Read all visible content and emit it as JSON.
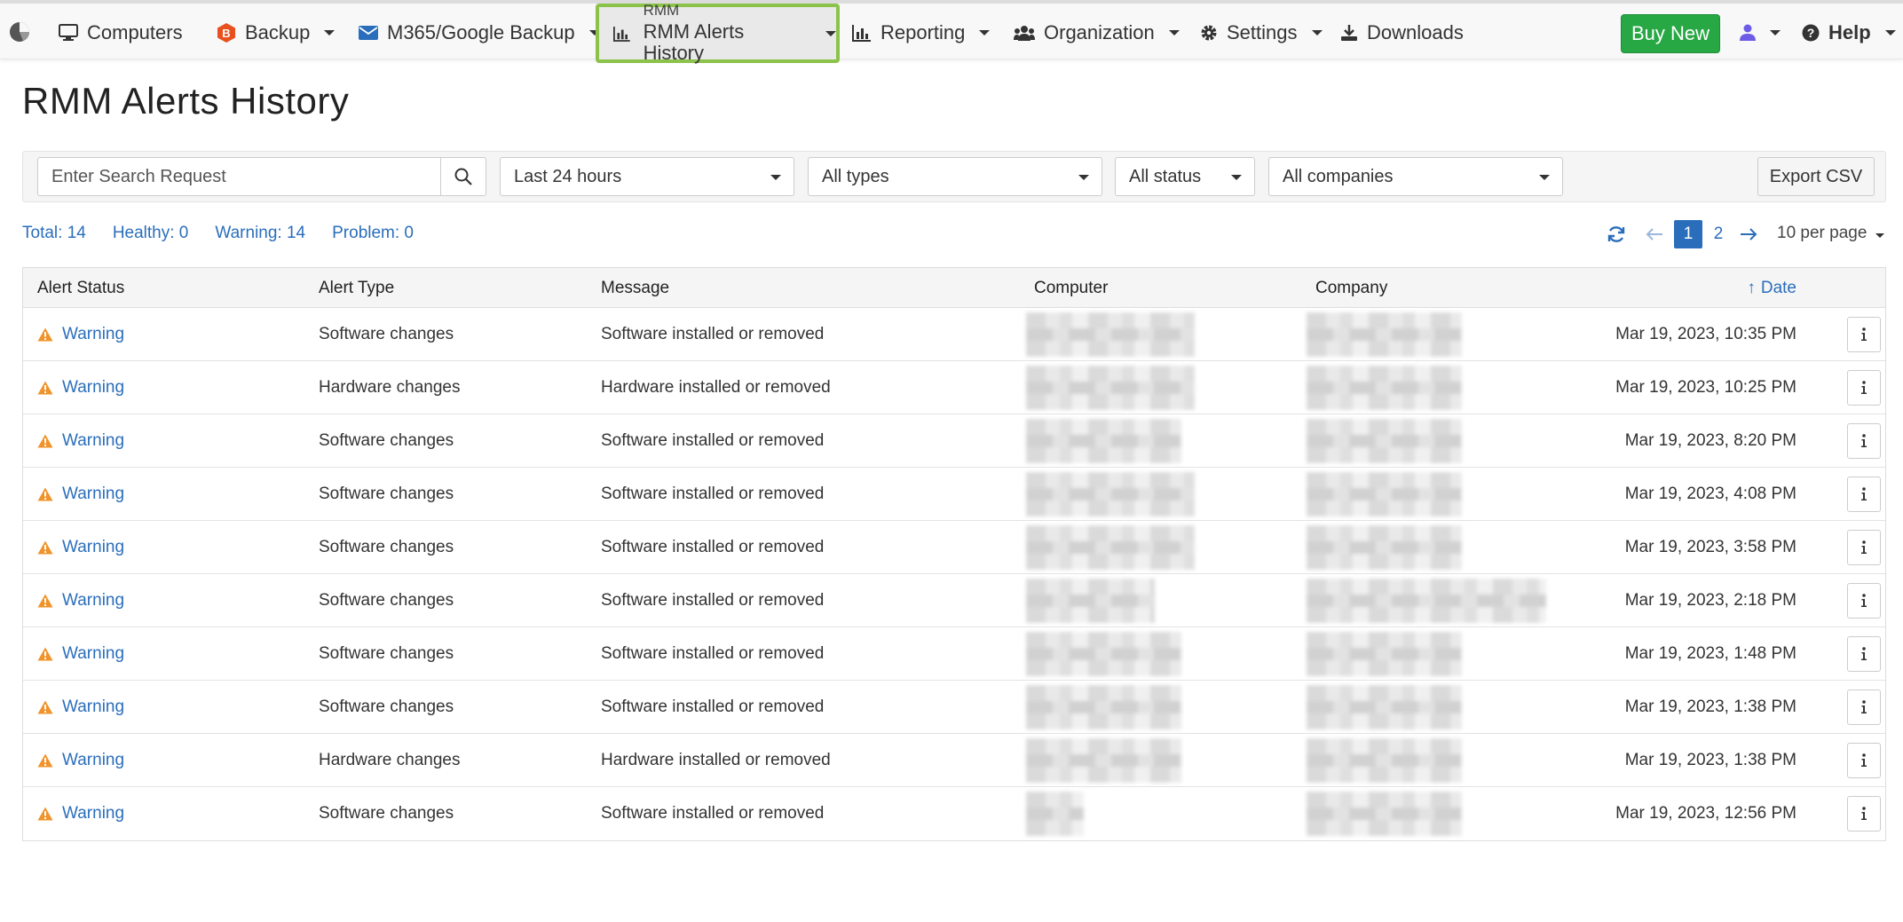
{
  "nav": {
    "items": [
      {
        "label": "Computers",
        "icon": "monitor-icon"
      },
      {
        "label": "Backup",
        "icon": "backup-icon"
      },
      {
        "label": "M365/Google Backup",
        "icon": "envelope-icon"
      },
      {
        "label_small": "RMM",
        "label": "RMM Alerts History",
        "icon": "bar-chart-icon"
      },
      {
        "label": "Reporting",
        "icon": "bar-chart-icon"
      },
      {
        "label": "Organization",
        "icon": "users-icon"
      },
      {
        "label": "Settings",
        "icon": "gear-icon"
      },
      {
        "label": "Downloads",
        "icon": "download-icon"
      }
    ],
    "buy_new": "Buy New",
    "help": "Help"
  },
  "page": {
    "title": "RMM Alerts History"
  },
  "filters": {
    "search_placeholder": "Enter Search Request",
    "period": "Last 24 hours",
    "types": "All types",
    "status": "All status",
    "companies": "All companies",
    "export": "Export CSV"
  },
  "stats": {
    "total": "Total: 14",
    "healthy": "Healthy: 0",
    "warning": "Warning: 14",
    "problem": "Problem: 0"
  },
  "pagination": {
    "pages": [
      "1",
      "2"
    ],
    "current": "1",
    "per_page": "10 per page"
  },
  "table": {
    "columns": [
      "Alert Status",
      "Alert Type",
      "Message",
      "Computer",
      "Company",
      "Date"
    ],
    "sort_indicator": "↑",
    "rows": [
      {
        "status": "Warning",
        "type": "Software changes",
        "message": "Software installed or removed",
        "date": "Mar 19, 2023, 10:35 PM"
      },
      {
        "status": "Warning",
        "type": "Hardware changes",
        "message": "Hardware installed or removed",
        "date": "Mar 19, 2023, 10:25 PM"
      },
      {
        "status": "Warning",
        "type": "Software changes",
        "message": "Software installed or removed",
        "date": "Mar 19, 2023, 8:20 PM"
      },
      {
        "status": "Warning",
        "type": "Software changes",
        "message": "Software installed or removed",
        "date": "Mar 19, 2023, 4:08 PM"
      },
      {
        "status": "Warning",
        "type": "Software changes",
        "message": "Software installed or removed",
        "date": "Mar 19, 2023, 3:58 PM"
      },
      {
        "status": "Warning",
        "type": "Software changes",
        "message": "Software installed or removed",
        "date": "Mar 19, 2023, 2:18 PM"
      },
      {
        "status": "Warning",
        "type": "Software changes",
        "message": "Software installed or removed",
        "date": "Mar 19, 2023, 1:48 PM"
      },
      {
        "status": "Warning",
        "type": "Software changes",
        "message": "Software installed or removed",
        "date": "Mar 19, 2023, 1:38 PM"
      },
      {
        "status": "Warning",
        "type": "Hardware changes",
        "message": "Hardware installed or removed",
        "date": "Mar 19, 2023, 1:38 PM"
      },
      {
        "status": "Warning",
        "type": "Software changes",
        "message": "Software installed or removed",
        "date": "Mar 19, 2023, 12:56 PM"
      }
    ]
  },
  "colors": {
    "accent": "#2a6ebb",
    "warning": "#f0932b",
    "buy": "#28a745",
    "active_nav_border": "#8bc34a"
  }
}
